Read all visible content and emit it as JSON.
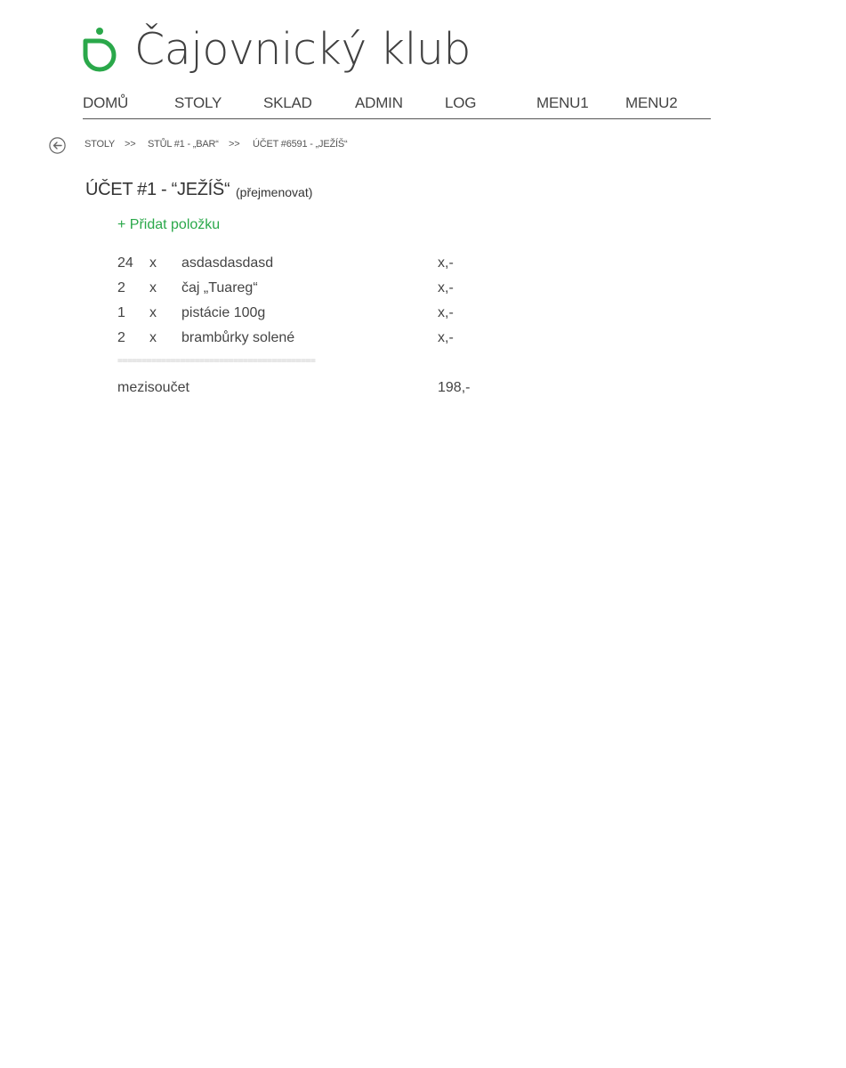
{
  "brand": {
    "title": "Čajovnický klub",
    "accent_color": "#2aa84a",
    "logo_icon": "tea-drop-logo"
  },
  "nav": {
    "items": [
      {
        "label": "DOMŮ"
      },
      {
        "label": "STOLY"
      },
      {
        "label": "SKLAD"
      },
      {
        "label": "ADMIN"
      },
      {
        "label": "LOG"
      },
      {
        "label": "MENU1"
      },
      {
        "label": "MENU2"
      }
    ]
  },
  "breadcrumb": {
    "back_icon": "arrow-left-circle-icon",
    "items": [
      "STOLY",
      "STŮL #1 - „BAR“",
      "ÚČET #6591 - „JEŽÍŠ“"
    ],
    "separator": ">>"
  },
  "account": {
    "title": "ÚČET #1 - “JEŽÍŠ“",
    "rename_label": "(přejmenovat)",
    "add_item_label": "+ Přidat položku",
    "items": [
      {
        "qty": "24",
        "x": "x",
        "name": "asdasdasdasd",
        "price": "x,-"
      },
      {
        "qty": "2",
        "x": "x",
        "name": "čaj „Tuareg“",
        "price": "x,-"
      },
      {
        "qty": "1",
        "x": "x",
        "name": "pistácie 100g",
        "price": "x,-"
      },
      {
        "qty": "2",
        "x": "x",
        "name": "brambůrky solené",
        "price": "x,-"
      }
    ],
    "separator": "=========================================",
    "subtotal_label": "mezisoučet",
    "subtotal_value": "198,-"
  }
}
